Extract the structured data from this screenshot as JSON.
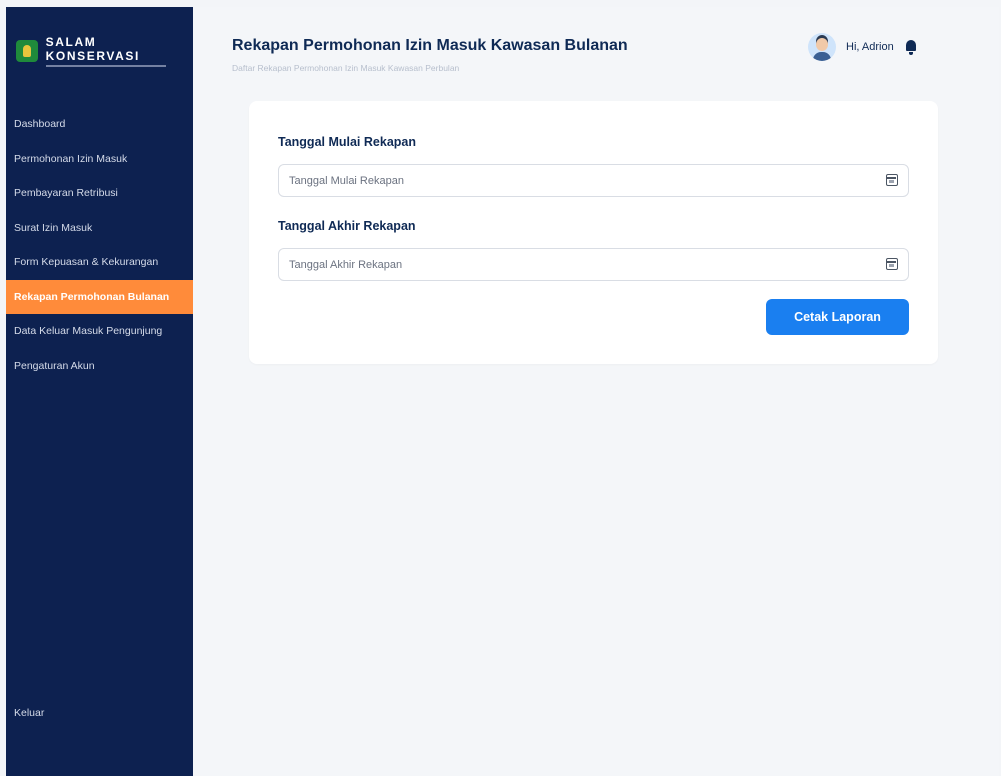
{
  "sidebar": {
    "brand": "SALAM KONSERVASI",
    "items": [
      {
        "label": "Dashboard"
      },
      {
        "label": "Permohonan Izin Masuk"
      },
      {
        "label": "Pembayaran Retribusi"
      },
      {
        "label": "Surat Izin Masuk"
      },
      {
        "label": "Form Kepuasan & Kekurangan"
      },
      {
        "label": "Rekapan Permohonan Bulanan"
      },
      {
        "label": "Data Keluar Masuk Pengunjung"
      },
      {
        "label": "Pengaturan Akun"
      }
    ],
    "active_index": 5,
    "logout": "Keluar"
  },
  "header": {
    "title": "Rekapan Permohonan Izin Masuk Kawasan Bulanan",
    "subtitle": "Daftar Rekapan Permohonan Izin Masuk Kawasan Perbulan",
    "greeting": "Hi, Adrion"
  },
  "form": {
    "start_label": "Tanggal Mulai Rekapan",
    "start_placeholder": "Tanggal Mulai Rekapan",
    "start_value": "",
    "end_label": "Tanggal Akhir Rekapan",
    "end_placeholder": "Tanggal Akhir Rekapan",
    "end_value": "",
    "submit": "Cetak Laporan"
  },
  "colors": {
    "sidebar_bg": "#0d2150",
    "active_item": "#ff8b3a",
    "primary_button": "#1a7ff0",
    "heading": "#0f2a55"
  },
  "icons": [
    "logo-icon",
    "avatar",
    "bell-icon",
    "calendar-icon"
  ]
}
